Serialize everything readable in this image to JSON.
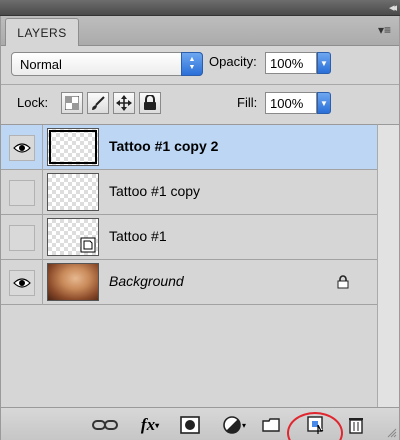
{
  "panel": {
    "tab_label": "LAYERS",
    "collapse_glyph": "◂◂",
    "menu_glyph": "▾≡"
  },
  "controls": {
    "blend_mode": "Normal",
    "opacity_label": "Opacity:",
    "opacity_value": "100%",
    "lock_label": "Lock:",
    "fill_label": "Fill:",
    "fill_value": "100%"
  },
  "layers": [
    {
      "name": "Tattoo #1 copy 2",
      "visible": true,
      "selected": true,
      "icon": "eye-icon"
    },
    {
      "name": "Tattoo #1 copy",
      "visible": false,
      "selected": false
    },
    {
      "name": "Tattoo #1",
      "visible": false,
      "selected": false
    },
    {
      "name": "Background",
      "visible": true,
      "selected": false,
      "locked": true,
      "icon": "lock-icon"
    }
  ],
  "bottom_icons": [
    "link-layers-icon",
    "fx-icon",
    "layer-mask-icon",
    "adjustment-layer-icon",
    "new-group-icon",
    "new-layer-icon",
    "trash-icon"
  ],
  "bottom_text": {
    "fx": "fx"
  },
  "colors": {
    "selection": "#bcd6f4",
    "accent": "#2a6fd8",
    "highlight_circle": "#e0262e"
  }
}
